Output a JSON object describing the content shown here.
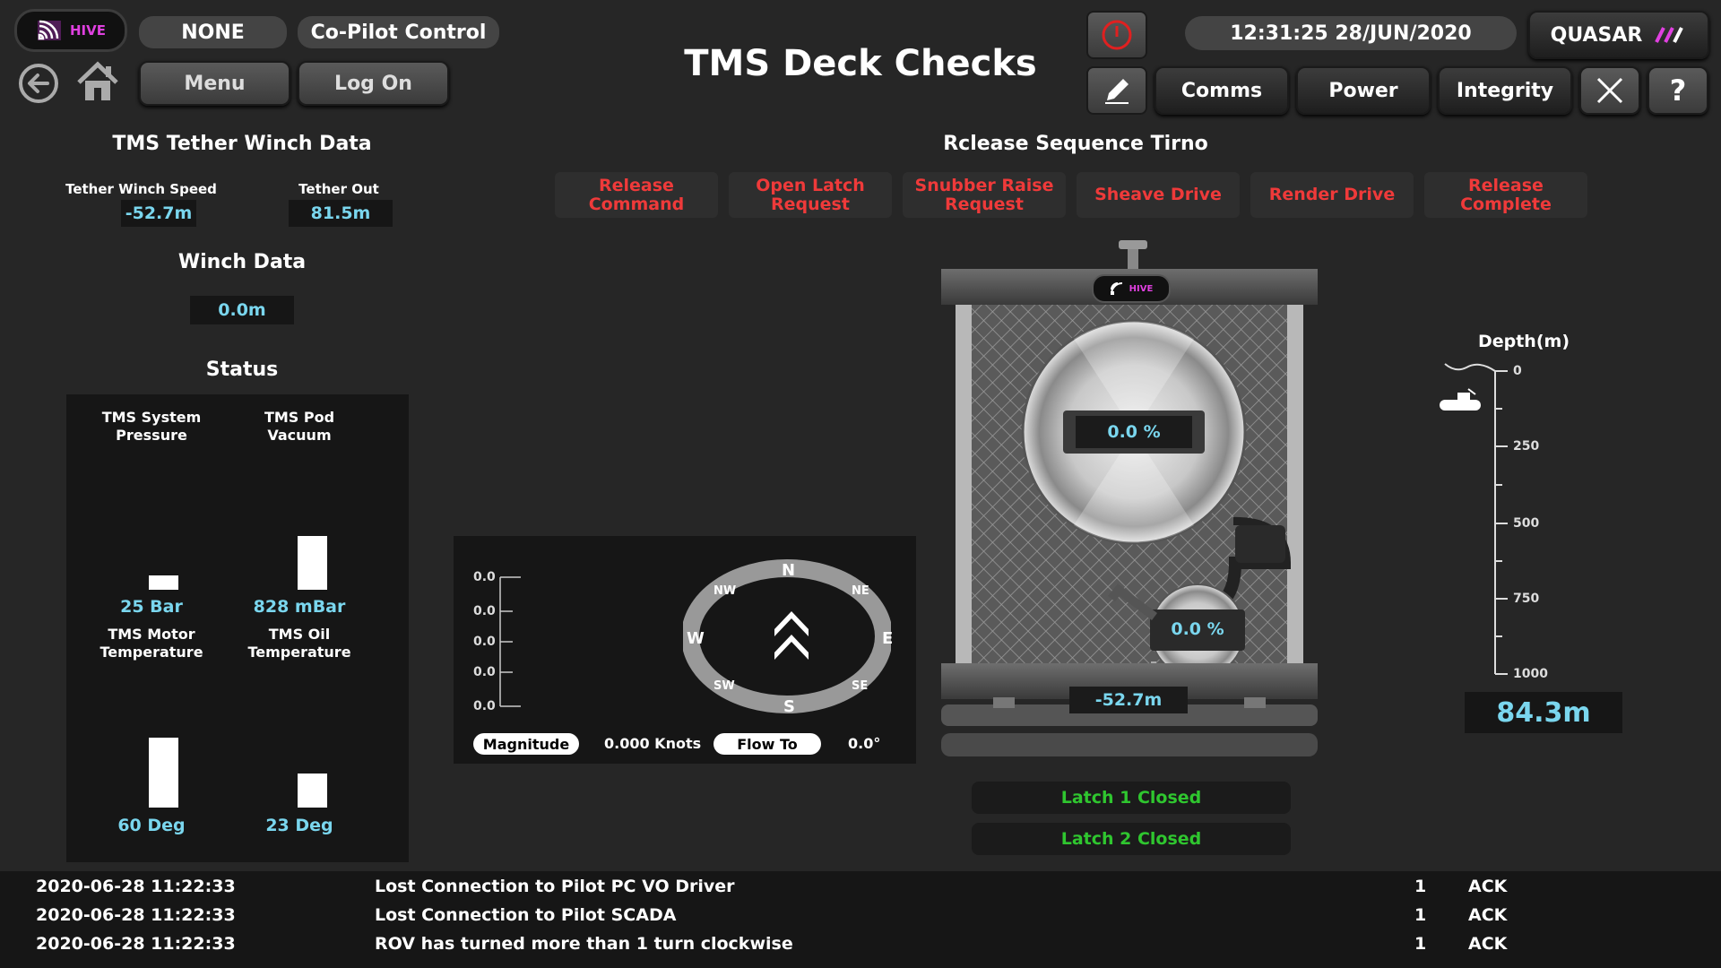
{
  "header": {
    "logo_text": "HIVE",
    "pilot_mode": "NONE",
    "control_mode": "Co-Pilot Control",
    "menu_label": "Menu",
    "logon_label": "Log On",
    "page_title": "TMS Deck Checks",
    "datetime": "12:31:25  28/JUN/2020",
    "system_name": "QUASAR",
    "comms_label": "Comms",
    "power_label": "Power",
    "integrity_label": "Integrity",
    "help_label": "?"
  },
  "tether": {
    "title": "TMS Tether Winch Data",
    "speed_label": "Tether Winch Speed",
    "speed_value": "-52.7m",
    "out_label": "Tether Out",
    "out_value": "81.5m"
  },
  "winch": {
    "title": "Winch Data",
    "value": "0.0m"
  },
  "status": {
    "title": "Status",
    "gauges": [
      {
        "label": "TMS System\nPressure",
        "value": "25 Bar",
        "level": 0.2
      },
      {
        "label": "TMS Pod\nVacuum",
        "value": "828 mBar",
        "level": 0.75
      },
      {
        "label": "TMS Motor\nTemperature",
        "value": "60 Deg",
        "level": 0.8
      },
      {
        "label": "TMS Oil\nTemperature",
        "value": "23 Deg",
        "level": 0.4
      }
    ]
  },
  "sequence": {
    "title": "Rclease Sequence Tirno",
    "steps": [
      "Release\nCommand",
      "Open Latch\nRequest",
      "Snubber Raise\nRequest",
      "Sheave Drive",
      "Render Drive",
      "Release\nComplete"
    ]
  },
  "current": {
    "scale_labels": [
      "0.0",
      "0.0",
      "0.0",
      "0.0",
      "0.0"
    ],
    "compass": [
      "N",
      "NE",
      "E",
      "SE",
      "S",
      "SW",
      "W",
      "NW"
    ],
    "magnitude_label": "Magnitude",
    "magnitude_value": "0.000 Knots",
    "flow_label": "Flow To",
    "flow_value": "0.0°"
  },
  "tms": {
    "logo_text": "HIVE",
    "drum_percent": "0.0 %",
    "sheave_percent": "0.0 %",
    "tether_value": "-52.7m",
    "latch1": "Latch 1 Closed",
    "latch2": "Latch 2 Closed"
  },
  "depth": {
    "title": "Depth(m)",
    "ticks": [
      "0",
      "250",
      "500",
      "750",
      "1000"
    ],
    "value": "84.3m"
  },
  "alarms": [
    {
      "date": "2020-06-28  11:22:33",
      "message": "Lost Connection to Pilot PC VO Driver",
      "count": "1",
      "ack": "ACK"
    },
    {
      "date": "2020-06-28  11:22:33",
      "message": "Lost Connection to Pilot SCADA",
      "count": "1",
      "ack": "ACK"
    },
    {
      "date": "2020-06-28  11:22:33",
      "message": "ROV has turned more than 1 turn clockwise",
      "count": "1",
      "ack": "ACK"
    }
  ],
  "colors": {
    "accent_cyan": "#7ad6ee",
    "sequence_red": "#ef3a3a",
    "latch_green": "#2fc62f",
    "logo_magenta": "#e040e0"
  }
}
